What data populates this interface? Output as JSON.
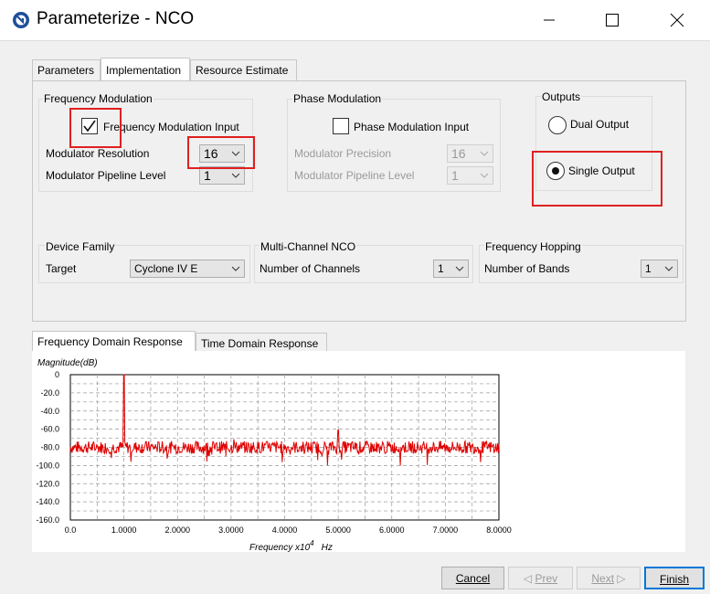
{
  "window": {
    "title": "Parameterize - NCO"
  },
  "tabs": [
    {
      "label": "Parameters"
    },
    {
      "label": "Implementation",
      "active": true
    },
    {
      "label": "Resource Estimate"
    }
  ],
  "freq_mod": {
    "group_label": "Frequency Modulation",
    "input_label": "Frequency Modulation Input",
    "input_checked": true,
    "resolution_label": "Modulator Resolution",
    "resolution_value": "16",
    "pipeline_label": "Modulator Pipeline Level",
    "pipeline_value": "1"
  },
  "phase_mod": {
    "group_label": "Phase Modulation",
    "input_label": "Phase Modulation Input",
    "input_checked": false,
    "precision_label": "Modulator Precision",
    "precision_value": "16",
    "pipeline_label": "Modulator Pipeline Level",
    "pipeline_value": "1"
  },
  "outputs": {
    "group_label": "Outputs",
    "dual_label": "Dual Output",
    "single_label": "Single Output",
    "selected": "Single Output"
  },
  "device_family": {
    "group_label": "Device Family",
    "target_label": "Target",
    "target_value": "Cyclone IV E"
  },
  "multi_channel": {
    "group_label": "Multi-Channel NCO",
    "channels_label": "Number of Channels",
    "channels_value": "1"
  },
  "freq_hopping": {
    "group_label": "Frequency Hopping",
    "bands_label": "Number of Bands",
    "bands_value": "1"
  },
  "bottom_tabs": [
    {
      "label": "Frequency Domain Response",
      "active": true
    },
    {
      "label": "Time Domain Response"
    }
  ],
  "chart_data": {
    "type": "line",
    "ylabel": "Magnitude(dB)",
    "xlabel": "Frequency x10",
    "xlabel_exp": "4",
    "xlabel_unit": "Hz",
    "xlim": [
      0,
      8
    ],
    "ylim": [
      -160,
      0
    ],
    "x_ticks": [
      "0.0",
      "1.0000",
      "2.0000",
      "3.0000",
      "4.0000",
      "5.0000",
      "6.0000",
      "7.0000",
      "8.0000"
    ],
    "y_ticks": [
      "0",
      "-20.0",
      "-40.0",
      "-60.0",
      "-80.0",
      "-100.0",
      "-120.0",
      "-140.0",
      "-160.0"
    ],
    "grid": true,
    "series": [
      {
        "color": "#e00000",
        "noise_floor_db": -80,
        "peaks": [
          {
            "x": 1.0,
            "y": 0
          },
          {
            "x": 3.05,
            "y": -71
          },
          {
            "x": 5.0,
            "y": -61
          }
        ]
      }
    ]
  },
  "buttons": {
    "cancel": "Cancel",
    "prev": "Prev",
    "next": "Next",
    "finish": "Finish"
  },
  "colors": {
    "highlight": "#e02020",
    "trace": "#e00000",
    "accent": "#0078d7"
  }
}
